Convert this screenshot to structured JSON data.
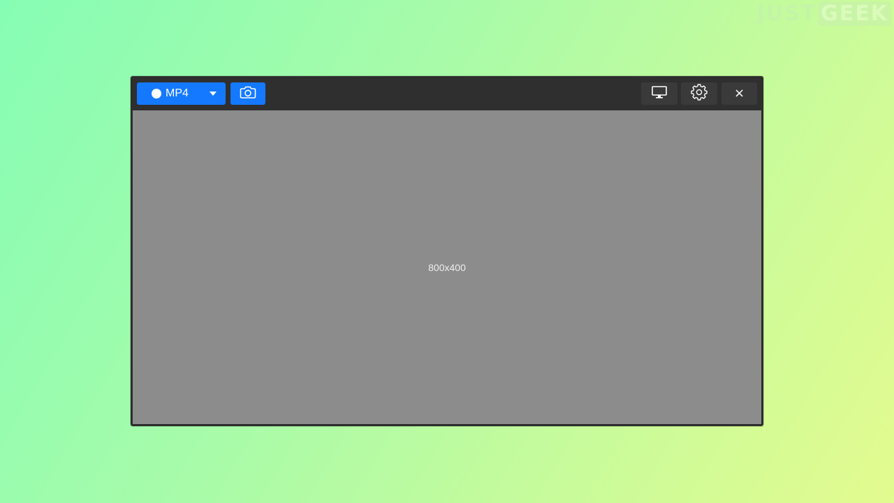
{
  "watermark": {
    "part1": "JUST",
    "part2": "GEEK"
  },
  "toolbar": {
    "record_format_label": "MP4",
    "record_dropdown_icon": "caret-down-icon",
    "record_dot_icon": "record-dot-icon",
    "camera_icon": "camera-icon",
    "display_icon": "monitor-icon",
    "settings_icon": "gear-icon",
    "close_label": "×"
  },
  "canvas": {
    "size_label": "800x400"
  },
  "colors": {
    "accent": "#1479ff",
    "toolbar_bg": "#2f2f2f",
    "canvas_bg": "#8c8c8c"
  }
}
